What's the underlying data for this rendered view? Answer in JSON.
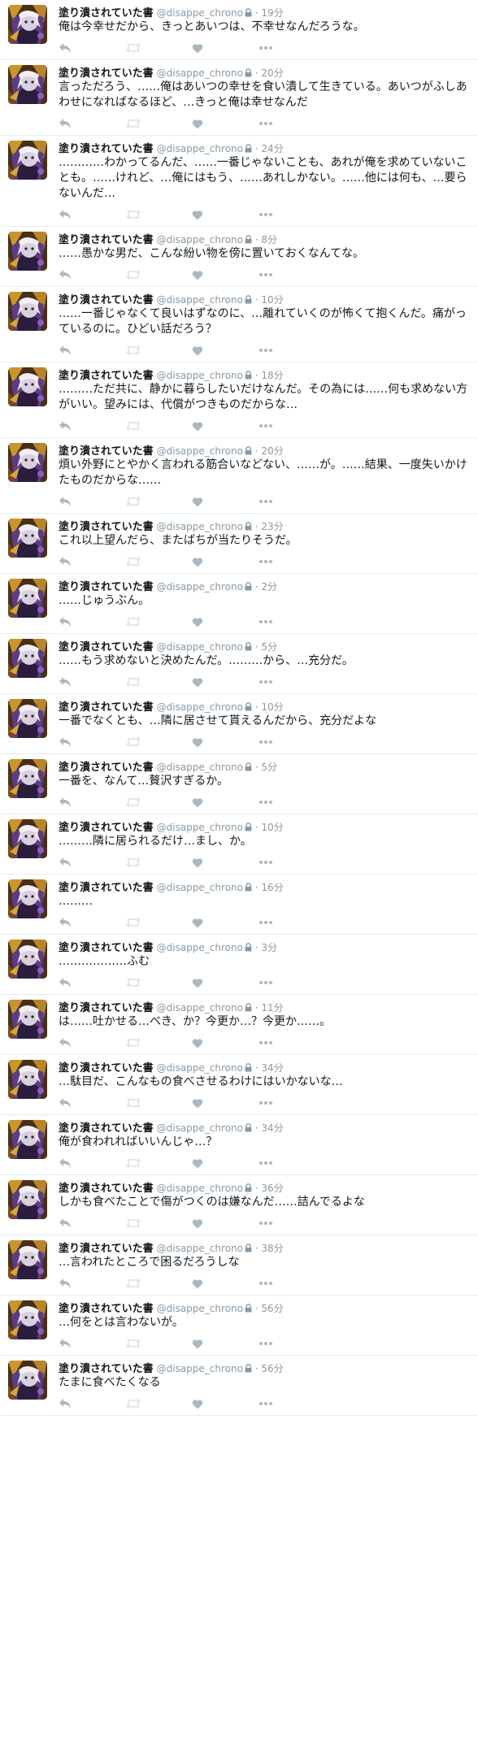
{
  "profile": {
    "display_name": "塗り潰されていた書",
    "handle": "@disappe_chrono",
    "separator": "·"
  },
  "icons": {
    "avatar": "character-avatar",
    "lock": "lock-icon",
    "reply": "reply-icon",
    "retweet": "retweet-icon",
    "like": "heart-icon",
    "more": "more-dots-icon"
  },
  "colors": {
    "text": "#14171a",
    "muted": "#8899a6",
    "action_icon": "#aab8c2",
    "divider": "#e6ecf0"
  },
  "tweets": [
    {
      "time": "19分",
      "text": "俺は今幸せだから、きっとあいつは、不幸せなんだろうな。"
    },
    {
      "time": "20分",
      "text": "言っただろう、……俺はあいつの幸せを食い潰して生きている。あいつがふしあわせになればなるほど、…きっと俺は幸せなんだ"
    },
    {
      "time": "24分",
      "text": "…………わかってるんだ、……一番じゃないことも、あれが俺を求めていないことも。……けれど、…俺にはもう、……あれしかない。……他には何も、…要らないんだ…"
    },
    {
      "time": "8分",
      "text": "……愚かな男だ、こんな紛い物を傍に置いておくなんてな。"
    },
    {
      "time": "10分",
      "text": "……一番じゃなくて良いはずなのに、…離れていくのが怖くて抱くんだ。痛がっているのに。ひどい話だろう？"
    },
    {
      "time": "18分",
      "text": "………ただ共に、静かに暮らしたいだけなんだ。その為には……何も求めない方がいい。望みには、代償がつきものだからな…"
    },
    {
      "time": "20分",
      "text": "煩い外野にとやかく言われる筋合いなどない、……が。……結果、一度失いかけたものだからな……"
    },
    {
      "time": "23分",
      "text": "これ以上望んだら、またばちが当たりそうだ。"
    },
    {
      "time": "2分",
      "text": "……じゅうぶん。"
    },
    {
      "time": "5分",
      "text": "……もう求めないと決めたんだ。………から、…充分だ。"
    },
    {
      "time": "10分",
      "text": "一番でなくとも、…隣に居させて貰えるんだから、充分だよな"
    },
    {
      "time": "5分",
      "text": "一番を、なんて…贅沢すぎるか。"
    },
    {
      "time": "10分",
      "text": "………隣に居られるだけ…まし、か。"
    },
    {
      "time": "16分",
      "text": "………"
    },
    {
      "time": "3分",
      "text": "………………ふむ"
    },
    {
      "time": "11分",
      "text": "は……吐かせる…べき、か？今更か…？今更か……。"
    },
    {
      "time": "34分",
      "text": "…駄目だ、こんなもの食べさせるわけにはいかないな…"
    },
    {
      "time": "34分",
      "text": "俺が食われればいいんじゃ…？"
    },
    {
      "time": "36分",
      "text": "しかも食べたことで傷がつくのは嫌なんだ……詰んでるよな"
    },
    {
      "time": "38分",
      "text": "…言われたところで困るだろうしな"
    },
    {
      "time": "56分",
      "text": "…何をとは言わないが。"
    },
    {
      "time": "56分",
      "text": "たまに食べたくなる"
    }
  ]
}
